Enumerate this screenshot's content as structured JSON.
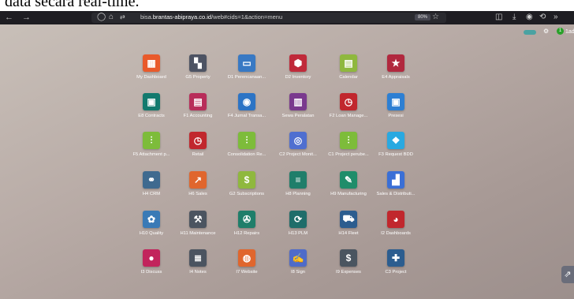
{
  "caption": "data secara real-time.",
  "browser": {
    "url_prefix": "bisa.",
    "url_domain": "brantas-abipraya.co.id",
    "url_path": "/web#cids=1&action=menu",
    "zoom": "80%"
  },
  "top_right": {
    "avatar_initial": "1",
    "username": "1ad"
  },
  "apps": [
    {
      "label": "My Dashboard",
      "icon": "▦",
      "color": "#e95a2b"
    },
    {
      "label": "G5 Property",
      "icon": "▚",
      "color": "#4d5363"
    },
    {
      "label": "D1 Perencanaan...",
      "icon": "▭",
      "color": "#3879c4"
    },
    {
      "label": "D2 Inventory",
      "icon": "⬢",
      "color": "#c02a3a"
    },
    {
      "label": "Calendar",
      "icon": "▤",
      "color": "#8fb83e"
    },
    {
      "label": "E4 Appraisals",
      "icon": "★",
      "color": "#b1283e"
    },
    {
      "label": "E8 Contracts",
      "icon": "▣",
      "color": "#137a6e"
    },
    {
      "label": "F1 Accounting",
      "icon": "▤",
      "color": "#b82d5a"
    },
    {
      "label": "F4 Jurnal Transa...",
      "icon": "◉",
      "color": "#2c74c5"
    },
    {
      "label": "Sewa Peralatan",
      "icon": "▥",
      "color": "#7a3a8e"
    },
    {
      "label": "F2 Loan Manage...",
      "icon": "◷",
      "color": "#c1272d"
    },
    {
      "label": "Presesi",
      "icon": "▣",
      "color": "#2d7fd3"
    },
    {
      "label": "F5 Attachment p...",
      "icon": "⫶",
      "color": "#7dbc3a"
    },
    {
      "label": "Retail",
      "icon": "◷",
      "color": "#c1272d"
    },
    {
      "label": "Consolidation Re...",
      "icon": "⫶",
      "color": "#7dbc3a"
    },
    {
      "label": "C2 Project Monit...",
      "icon": "◎",
      "color": "#4f6fd0"
    },
    {
      "label": "C1 Project perube...",
      "icon": "⫶",
      "color": "#7dbc3a"
    },
    {
      "label": "F3 Request BDD",
      "icon": "❖",
      "color": "#29a9e1"
    },
    {
      "label": "H4 CRM",
      "icon": "⚭",
      "color": "#3f6a8f"
    },
    {
      "label": "H6 Sales",
      "icon": "↗",
      "color": "#e0662d"
    },
    {
      "label": "G2 Subscriptions",
      "icon": "$",
      "color": "#8fb83e"
    },
    {
      "label": "H8 Planning",
      "icon": "≡",
      "color": "#1f7e6a"
    },
    {
      "label": "H9 Manufacturing",
      "icon": "✎",
      "color": "#1f8d6a"
    },
    {
      "label": "Sales & Distributi...",
      "icon": "▟",
      "color": "#3a6fd6"
    },
    {
      "label": "H10 Quality",
      "icon": "✿",
      "color": "#3a7ab6"
    },
    {
      "label": "H11 Maintenance",
      "icon": "⚒",
      "color": "#4b5460"
    },
    {
      "label": "H12 Repairs",
      "icon": "✇",
      "color": "#1f7e6a"
    },
    {
      "label": "H13 PLM",
      "icon": "⟳",
      "color": "#1f6d6a"
    },
    {
      "label": "H14 Fleet",
      "icon": "⛟",
      "color": "#2c5d8f"
    },
    {
      "label": "I2 Dashboards",
      "icon": "◕",
      "color": "#c1272d"
    },
    {
      "label": "I3 Discuss",
      "icon": "●",
      "color": "#c2245c"
    },
    {
      "label": "I4 Notes",
      "icon": "≣",
      "color": "#4b5460"
    },
    {
      "label": "I7 Website",
      "icon": "◍",
      "color": "#e0662d"
    },
    {
      "label": "I8 Sign",
      "icon": "✍",
      "color": "#4e6bc9"
    },
    {
      "label": "I9 Expenses",
      "icon": "$",
      "color": "#4a5560"
    },
    {
      "label": "C3 Project",
      "icon": "✚",
      "color": "#2c5d8f"
    }
  ]
}
